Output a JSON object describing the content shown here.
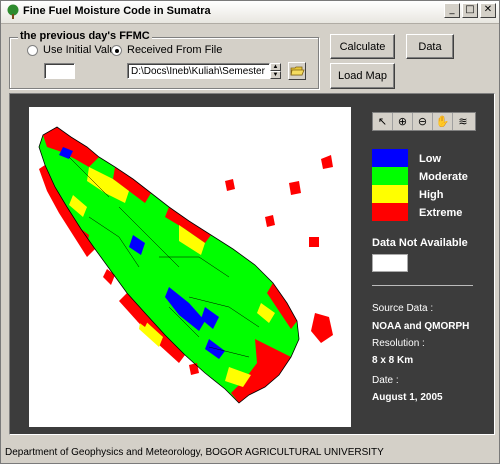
{
  "window": {
    "title": "Fine Fuel Moisture Code in Sumatra",
    "controls": [
      "_",
      "□",
      "✕"
    ]
  },
  "ffmc_group": {
    "legend": "the previous day's FFMC",
    "options": [
      {
        "label": "Use Initial Value",
        "selected": false
      },
      {
        "label": "Received From File",
        "selected": true
      }
    ],
    "initial_value": "",
    "file_path": "D:\\Docs\\Ineb\\Kuliah\\Semester"
  },
  "buttons": {
    "calculate": "Calculate",
    "data": "Data",
    "load_map": "Load Map"
  },
  "toolbar": {
    "tools": [
      "arrow-pointer-icon",
      "zoom-in-icon",
      "zoom-out-icon",
      "pan-hand-icon",
      "layers-icon"
    ]
  },
  "legend": {
    "items": [
      {
        "label": "Low",
        "color": "#0000ff"
      },
      {
        "label": "Moderate",
        "color": "#00ff00"
      },
      {
        "label": "High",
        "color": "#ffff00"
      },
      {
        "label": "Extreme",
        "color": "#ff0000"
      }
    ],
    "not_available_label": "Data Not Available",
    "not_available_color": "#ffffff"
  },
  "info": {
    "source_label": "Source Data :",
    "source_value": "NOAA and QMORPH",
    "resolution_label": "Resolution :",
    "resolution_value": "8 x 8 Km",
    "date_label": "Date :",
    "date_value": "August 1, 2005"
  },
  "status_bar": "Department of Geophysics and Meteorology, BOGOR AGRICULTURAL UNIVERSITY"
}
